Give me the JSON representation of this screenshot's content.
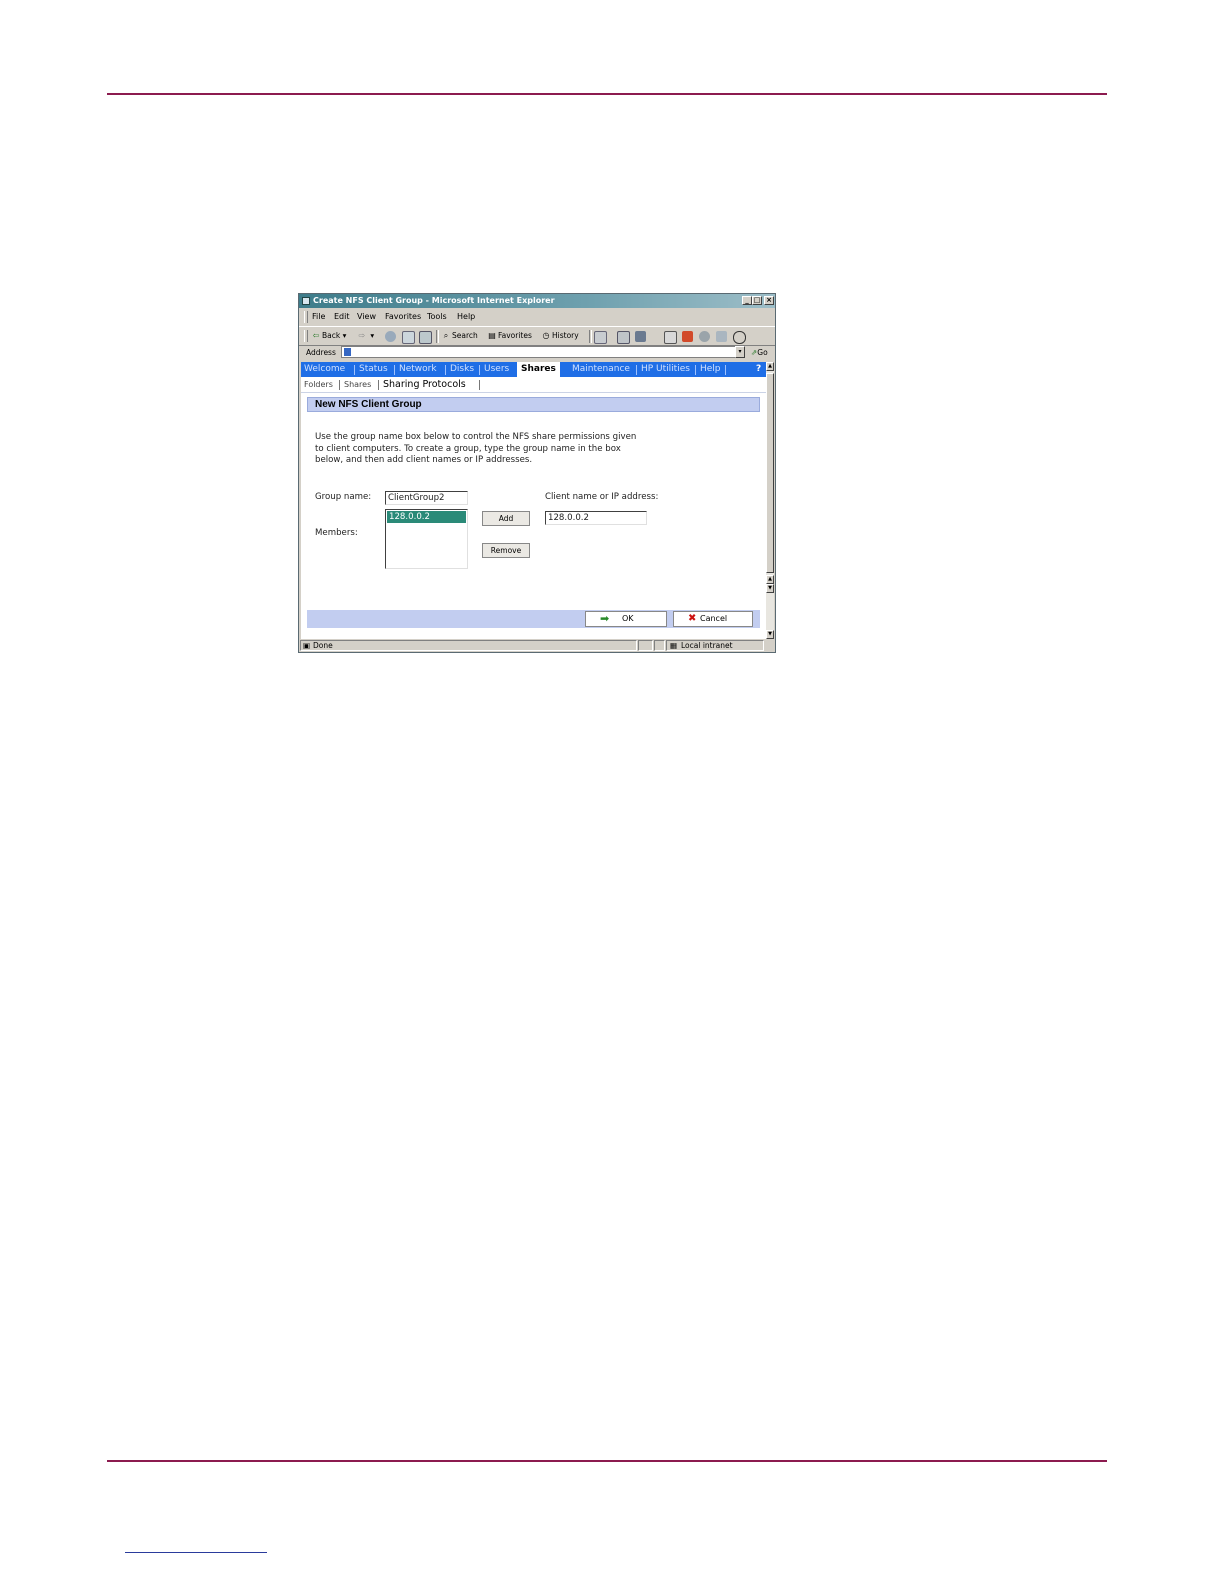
{
  "window": {
    "title": "Create NFS Client Group - Microsoft Internet Explorer",
    "controls": {
      "minimize": "_",
      "maximize": "□",
      "close": "×"
    }
  },
  "menu": [
    "File",
    "Edit",
    "View",
    "Favorites",
    "Tools",
    "Help"
  ],
  "toolbar": {
    "back": "Back",
    "search": "Search",
    "favorites": "Favorites",
    "history": "History"
  },
  "address": {
    "label": "Address",
    "value": "",
    "go": "Go"
  },
  "nav": {
    "tabs": [
      "Welcome",
      "Status",
      "Network",
      "Disks",
      "Users",
      "Shares",
      "Maintenance",
      "HP Utilities",
      "Help"
    ],
    "active": "Shares",
    "help_icon": "?"
  },
  "subnav": {
    "tabs": [
      "Folders",
      "Shares",
      "Sharing Protocols"
    ],
    "active": "Sharing Protocols"
  },
  "panel": {
    "title": "New NFS Client Group",
    "intro_lines": [
      "Use the group name box below to control the NFS share permissions given",
      "to client computers. To create a group, type the group name in the box",
      "below, and then add client names or IP addresses."
    ]
  },
  "form": {
    "group_name_label": "Group name:",
    "group_name_value": "ClientGroup2",
    "members_label": "Members:",
    "members": [
      "128.0.0.2"
    ],
    "client_label": "Client name or IP address:",
    "client_value": "128.0.0.2",
    "add_label": "Add",
    "remove_label": "Remove"
  },
  "footer": {
    "ok_label": "OK",
    "cancel_label": "Cancel"
  },
  "status": {
    "text": "Done",
    "zone": "Local intranet"
  },
  "colors": {
    "page_rule": "#8c1b4f",
    "nav_blue": "#1f6ee6",
    "panel_blue": "#c2cdf0",
    "selection": "#2a8a78"
  }
}
